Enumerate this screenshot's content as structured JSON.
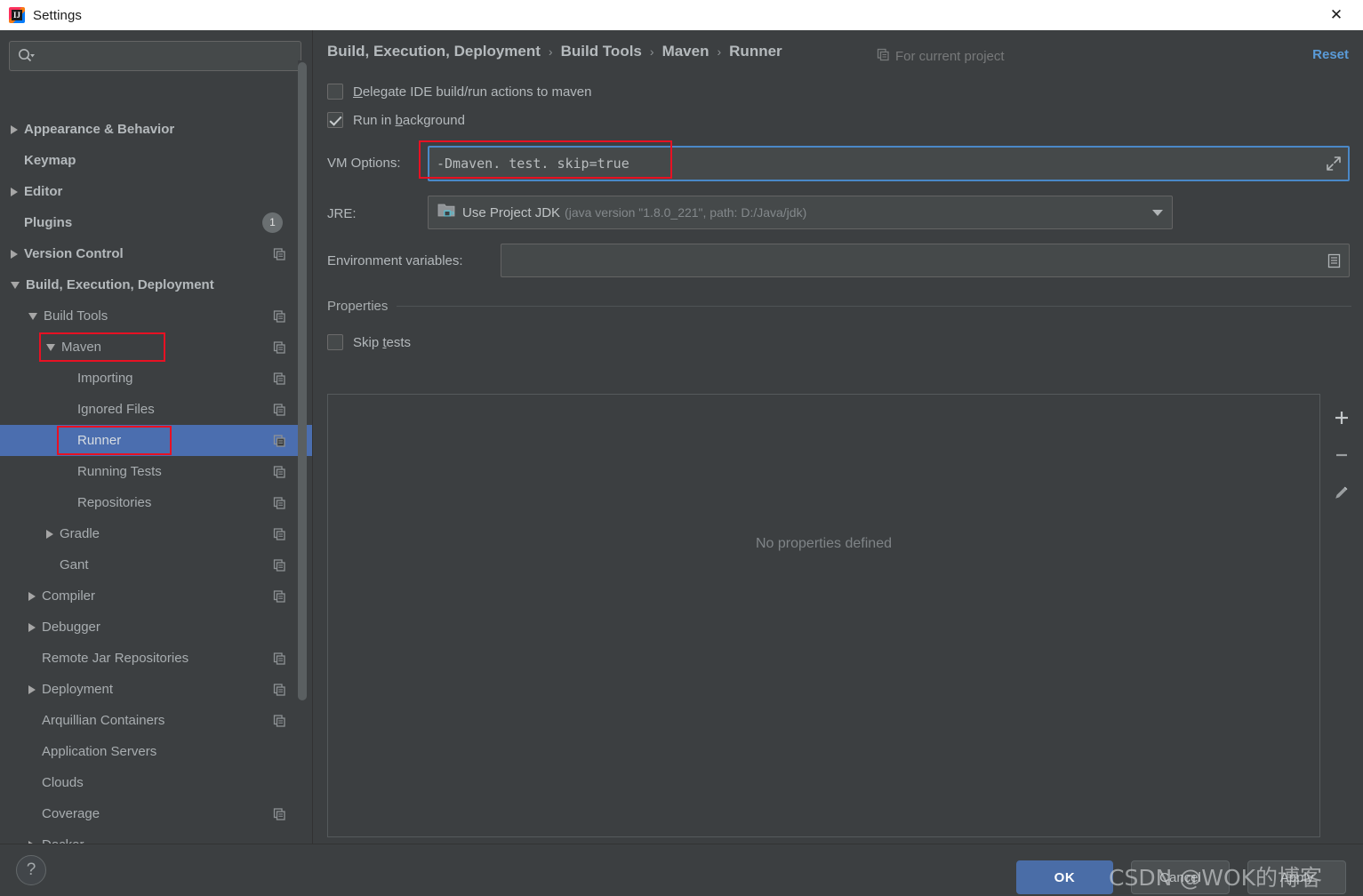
{
  "window": {
    "title": "Settings",
    "app_icon": "intellij-idea-icon",
    "close_icon": "close-icon"
  },
  "sidebar": {
    "search": {
      "placeholder": "",
      "value": "",
      "icon": "search-icon"
    },
    "items": [
      {
        "label": "Appearance & Behavior",
        "indent": 0,
        "arrow": "right",
        "bold": true,
        "copy": false,
        "badge": null,
        "selected": false
      },
      {
        "label": "Keymap",
        "indent": 0,
        "arrow": "none",
        "bold": true,
        "copy": false,
        "badge": null,
        "selected": false
      },
      {
        "label": "Editor",
        "indent": 0,
        "arrow": "right",
        "bold": true,
        "copy": false,
        "badge": null,
        "selected": false
      },
      {
        "label": "Plugins",
        "indent": 0,
        "arrow": "none",
        "bold": true,
        "copy": false,
        "badge": "1",
        "selected": false
      },
      {
        "label": "Version Control",
        "indent": 0,
        "arrow": "right",
        "bold": true,
        "copy": true,
        "badge": null,
        "selected": false
      },
      {
        "label": "Build, Execution, Deployment",
        "indent": 0,
        "arrow": "down",
        "bold": true,
        "copy": false,
        "badge": null,
        "selected": false
      },
      {
        "label": "Build Tools",
        "indent": 1,
        "arrow": "down",
        "bold": false,
        "copy": true,
        "badge": null,
        "selected": false
      },
      {
        "label": "Maven",
        "indent": 2,
        "arrow": "down",
        "bold": false,
        "copy": true,
        "badge": null,
        "selected": false
      },
      {
        "label": "Importing",
        "indent": 3,
        "arrow": "none",
        "bold": false,
        "copy": true,
        "badge": null,
        "selected": false
      },
      {
        "label": "Ignored Files",
        "indent": 3,
        "arrow": "none",
        "bold": false,
        "copy": true,
        "badge": null,
        "selected": false
      },
      {
        "label": "Runner",
        "indent": 3,
        "arrow": "none",
        "bold": false,
        "copy": true,
        "badge": null,
        "selected": true
      },
      {
        "label": "Running Tests",
        "indent": 3,
        "arrow": "none",
        "bold": false,
        "copy": true,
        "badge": null,
        "selected": false
      },
      {
        "label": "Repositories",
        "indent": 3,
        "arrow": "none",
        "bold": false,
        "copy": true,
        "badge": null,
        "selected": false
      },
      {
        "label": "Gradle",
        "indent": 2,
        "arrow": "right",
        "bold": false,
        "copy": true,
        "badge": null,
        "selected": false
      },
      {
        "label": "Gant",
        "indent": 2,
        "arrow": "none",
        "bold": false,
        "copy": true,
        "badge": null,
        "selected": false
      },
      {
        "label": "Compiler",
        "indent": 1,
        "arrow": "right",
        "bold": false,
        "copy": true,
        "badge": null,
        "selected": false
      },
      {
        "label": "Debugger",
        "indent": 1,
        "arrow": "right",
        "bold": false,
        "copy": false,
        "badge": null,
        "selected": false
      },
      {
        "label": "Remote Jar Repositories",
        "indent": 1,
        "arrow": "none",
        "bold": false,
        "copy": true,
        "badge": null,
        "selected": false
      },
      {
        "label": "Deployment",
        "indent": 1,
        "arrow": "right",
        "bold": false,
        "copy": true,
        "badge": null,
        "selected": false
      },
      {
        "label": "Arquillian Containers",
        "indent": 1,
        "arrow": "none",
        "bold": false,
        "copy": true,
        "badge": null,
        "selected": false
      },
      {
        "label": "Application Servers",
        "indent": 1,
        "arrow": "none",
        "bold": false,
        "copy": false,
        "badge": null,
        "selected": false
      },
      {
        "label": "Clouds",
        "indent": 1,
        "arrow": "none",
        "bold": false,
        "copy": false,
        "badge": null,
        "selected": false
      },
      {
        "label": "Coverage",
        "indent": 1,
        "arrow": "none",
        "bold": false,
        "copy": true,
        "badge": null,
        "selected": false
      },
      {
        "label": "Docker",
        "indent": 1,
        "arrow": "right",
        "bold": false,
        "copy": false,
        "badge": null,
        "selected": false
      }
    ]
  },
  "header": {
    "breadcrumbs": [
      "Build, Execution, Deployment",
      "Build Tools",
      "Maven",
      "Runner"
    ],
    "separator": "›",
    "for_current_project": "For current project",
    "for_current_project_icon": "copy-icon",
    "reset_label": "Reset",
    "reset_color": "#5a9bd8"
  },
  "main": {
    "delegate_checkbox": {
      "label_pre": "D",
      "label_post": "elegate IDE build/run actions to maven",
      "checked": false
    },
    "run_background_checkbox": {
      "label_pre": "Run in ",
      "label_mid": "b",
      "label_post": "ackground",
      "checked": true
    },
    "vm_options": {
      "label": "VM Options:",
      "value": "-Dmaven. test. skip=true",
      "expand_icon": "expand-arrows-icon",
      "focused": true,
      "annotated": true
    },
    "jre": {
      "label": "JRE:",
      "selected_main": "Use Project JDK",
      "selected_detail": "(java version \"1.8.0_221\", path: D:/Java/jdk)",
      "icon": "jdk-folder-icon",
      "caret_icon": "chevron-down-icon"
    },
    "env_vars": {
      "label": "Environment variables:",
      "value": "",
      "browse_icon": "list-browse-icon"
    },
    "properties_section": {
      "title": "Properties",
      "skip_tests": {
        "label_pre": "Skip ",
        "label_mid": "t",
        "label_post": "ests",
        "checked": false
      },
      "empty_text": "No properties defined",
      "tools": [
        {
          "name": "add-property-button",
          "icon": "plus-icon"
        },
        {
          "name": "remove-property-button",
          "icon": "minus-icon"
        },
        {
          "name": "edit-property-button",
          "icon": "pencil-icon"
        }
      ]
    }
  },
  "footer": {
    "help_label": "?",
    "ok_label": "OK",
    "cancel_label": "Cancel",
    "apply_label": "Apply"
  },
  "watermark": {
    "text": "CSDN @WOK的博客"
  },
  "colors": {
    "background": "#3c3f41",
    "selection": "#4b6eaf",
    "accent_link": "#5a9bd8",
    "annotation_red": "#e81123",
    "primary_button": "#4a6da7",
    "field_background": "#45494a",
    "focus_border": "#4a88c7"
  }
}
